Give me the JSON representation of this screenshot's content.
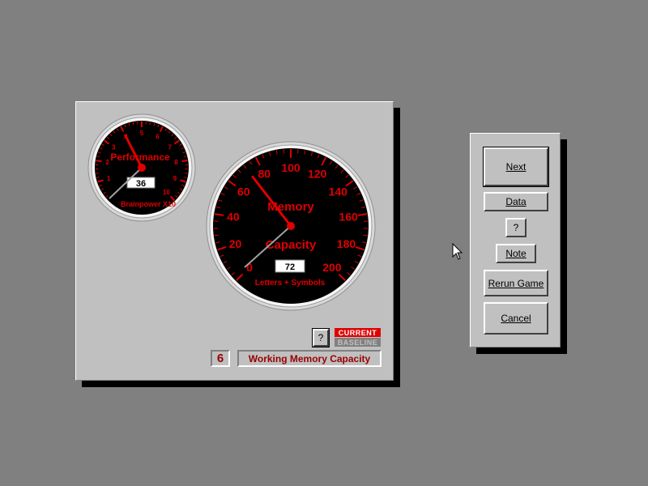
{
  "performance_gauge": {
    "title": "Performance",
    "subtitle": "Brainpower X10",
    "value": "36",
    "ticks": [
      "1",
      "2",
      "3",
      "4",
      "5",
      "6",
      "7",
      "8",
      "9",
      "10"
    ],
    "needle_value": 4,
    "min": 0,
    "max": 10
  },
  "memory_gauge": {
    "title_line1": "Memory",
    "title_line2": "Capacity",
    "subtitle": "Letters + Symbols",
    "value": "72",
    "ticks": [
      "0",
      "20",
      "40",
      "60",
      "80",
      "100",
      "120",
      "140",
      "160",
      "180",
      "200"
    ],
    "needle_value": 72,
    "min": 0,
    "max": 200
  },
  "help_button_label": "?",
  "legend": {
    "current": "CURRENT",
    "baseline": "BASELINE"
  },
  "status": {
    "level": "6",
    "label": "Working Memory Capacity"
  },
  "buttons": {
    "next": "Next",
    "data": "Data",
    "help": "?",
    "note": "Note",
    "rerun": "Rerun Game",
    "cancel": "Cancel"
  },
  "colors": {
    "gauge_red": "#e00000",
    "dial_black": "#000000",
    "panel_gray": "#c0c0c0",
    "desktop_gray": "#808080"
  }
}
